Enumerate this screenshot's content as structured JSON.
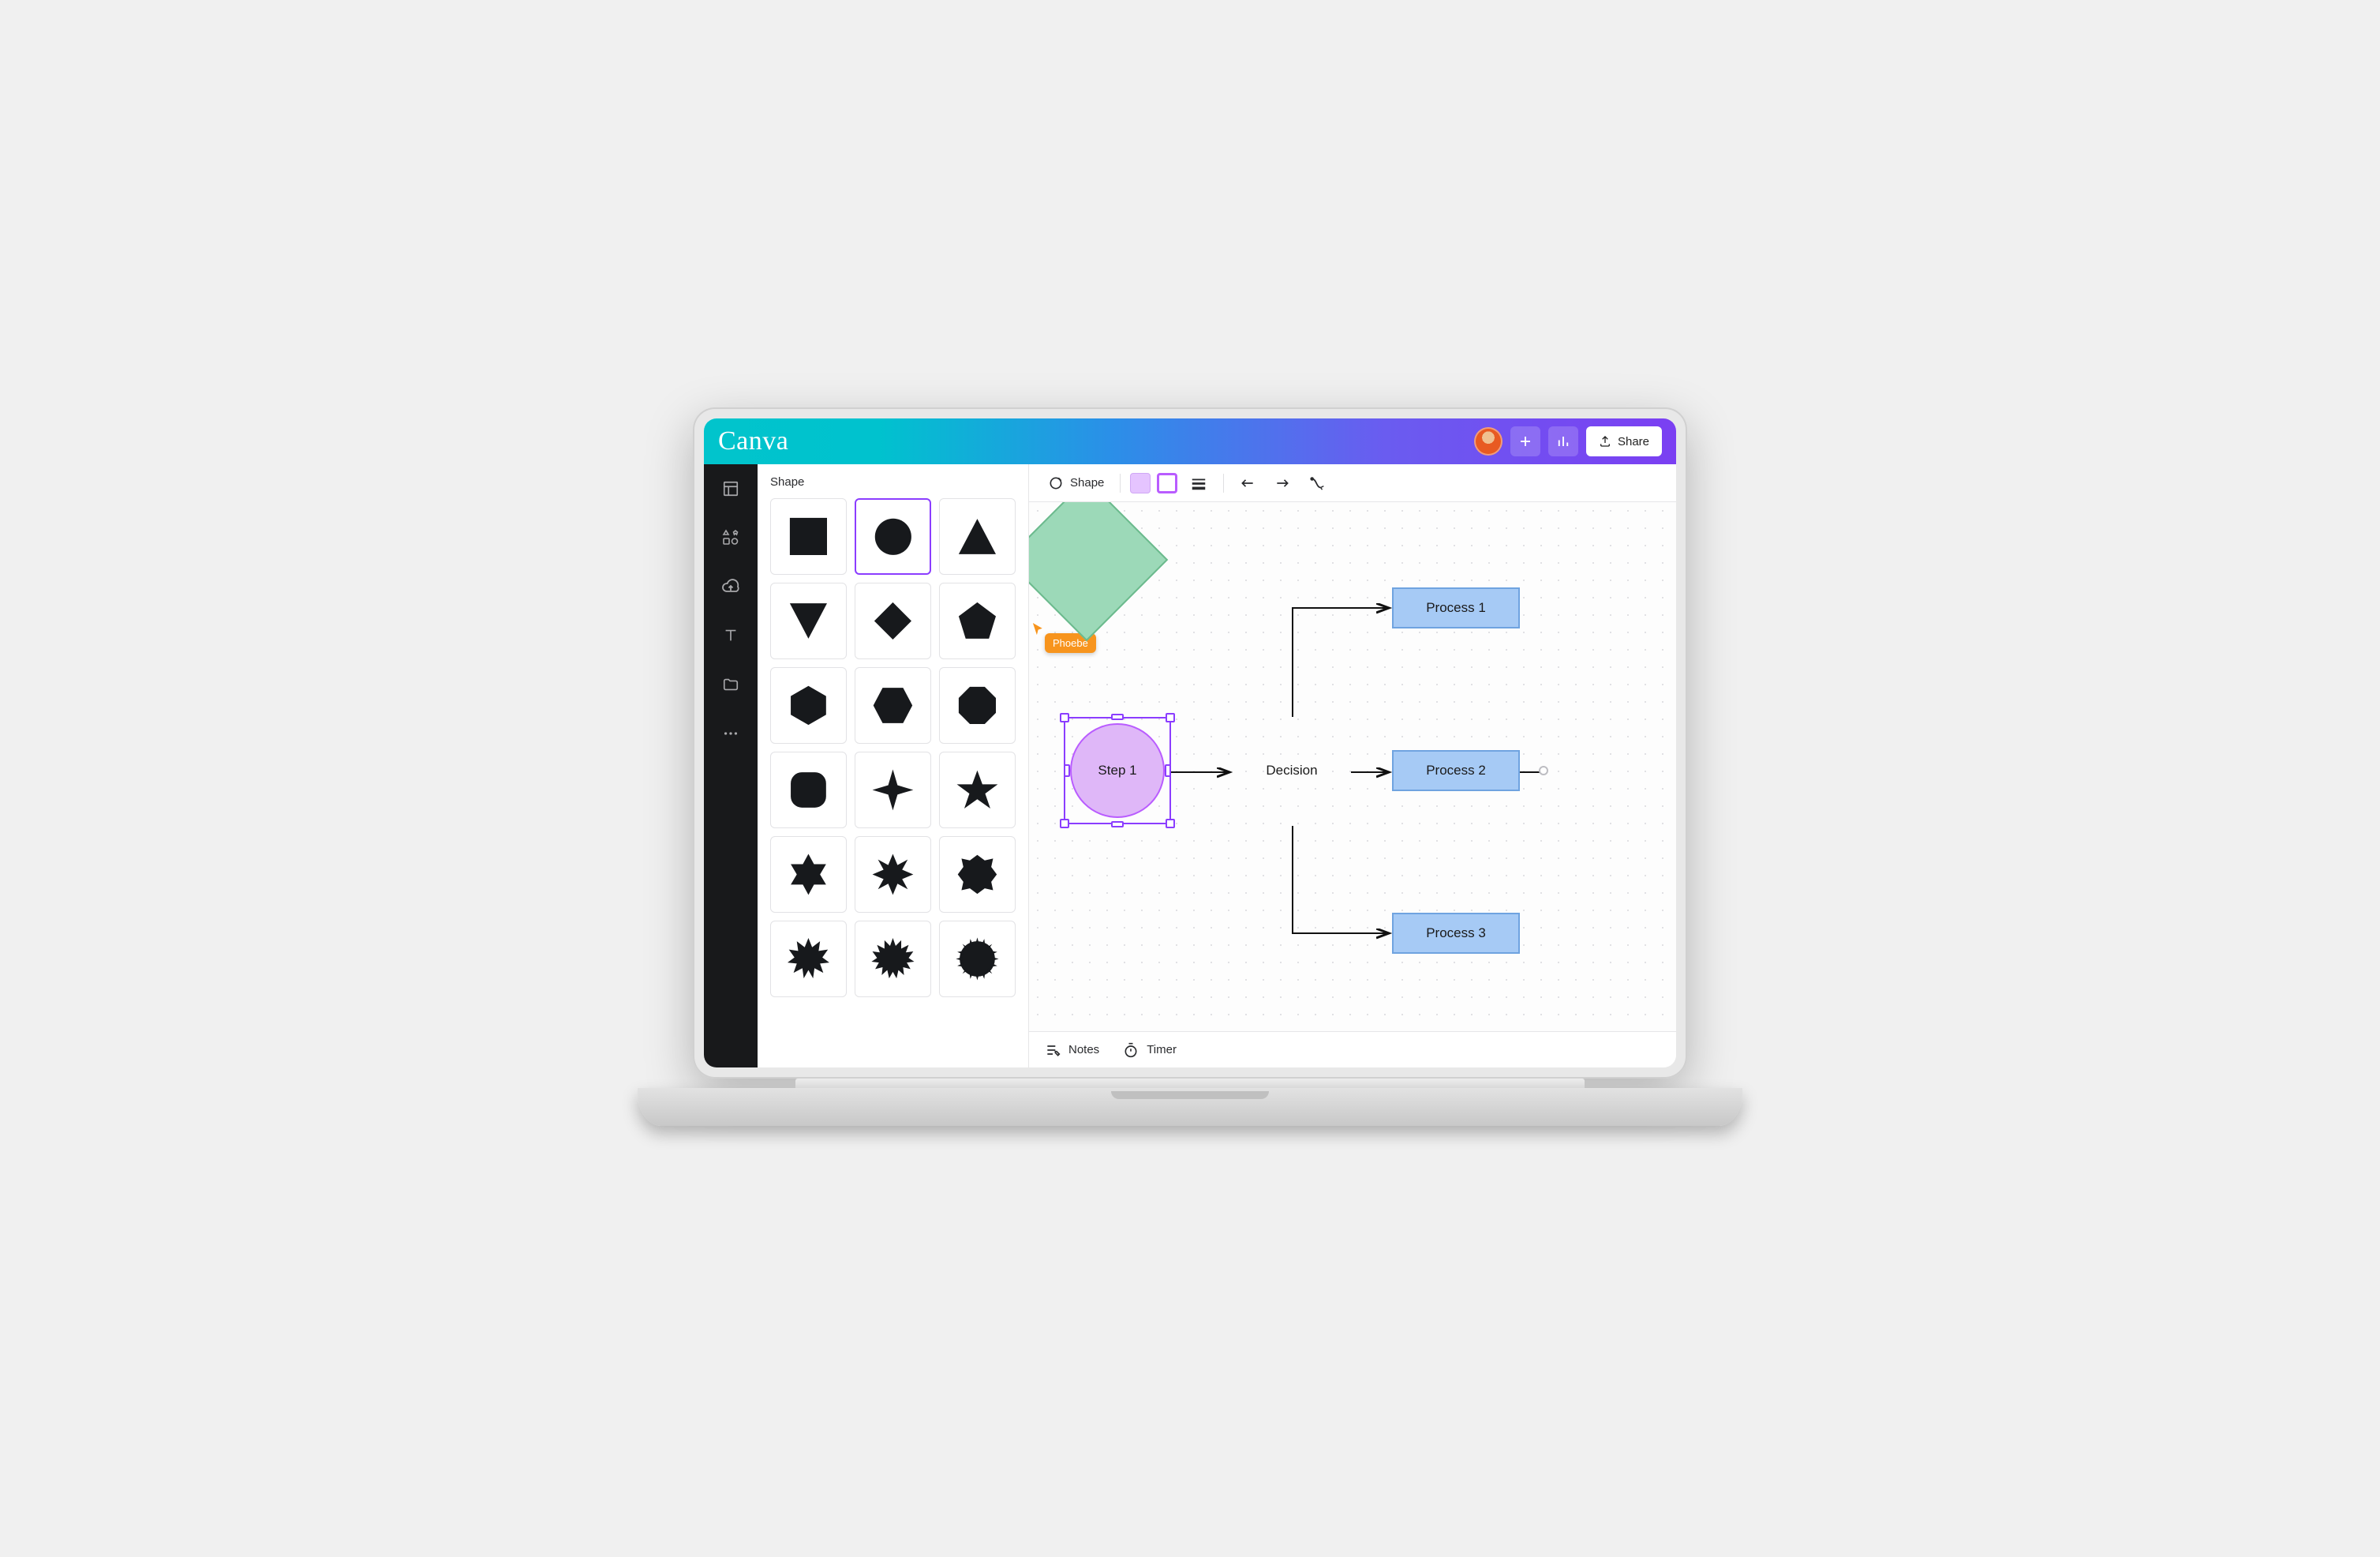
{
  "app": {
    "logo": "Canva"
  },
  "topbar": {
    "share_label": "Share"
  },
  "sidepanel": {
    "title": "Shape",
    "shapes": [
      "square",
      "circle",
      "triangle",
      "triangle-down",
      "diamond",
      "pentagon",
      "hexagon",
      "hexagon-flat",
      "octagon-fill",
      "round-square",
      "star4",
      "star5",
      "star6",
      "star8",
      "seal8",
      "burst12",
      "burst16",
      "burst20"
    ],
    "selected_index": 1
  },
  "context_toolbar": {
    "shape_label": "Shape",
    "fill_color": "#e5c4ff",
    "border_color": "#b95cff"
  },
  "collaborator": {
    "name": "Phoebe",
    "color": "#f7941d"
  },
  "flowchart": {
    "step": "Step 1",
    "decision": "Decision",
    "process1": "Process 1",
    "process2": "Process 2",
    "process3": "Process 3"
  },
  "bottombar": {
    "notes": "Notes",
    "timer": "Timer"
  }
}
